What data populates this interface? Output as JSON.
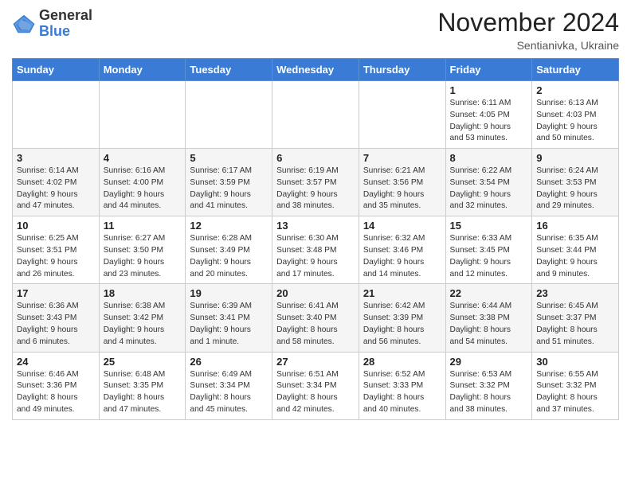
{
  "logo": {
    "general": "General",
    "blue": "Blue"
  },
  "header": {
    "month": "November 2024",
    "location": "Sentianivka, Ukraine"
  },
  "days_of_week": [
    "Sunday",
    "Monday",
    "Tuesday",
    "Wednesday",
    "Thursday",
    "Friday",
    "Saturday"
  ],
  "weeks": [
    [
      {
        "day": "",
        "info": ""
      },
      {
        "day": "",
        "info": ""
      },
      {
        "day": "",
        "info": ""
      },
      {
        "day": "",
        "info": ""
      },
      {
        "day": "",
        "info": ""
      },
      {
        "day": "1",
        "info": "Sunrise: 6:11 AM\nSunset: 4:05 PM\nDaylight: 9 hours\nand 53 minutes."
      },
      {
        "day": "2",
        "info": "Sunrise: 6:13 AM\nSunset: 4:03 PM\nDaylight: 9 hours\nand 50 minutes."
      }
    ],
    [
      {
        "day": "3",
        "info": "Sunrise: 6:14 AM\nSunset: 4:02 PM\nDaylight: 9 hours\nand 47 minutes."
      },
      {
        "day": "4",
        "info": "Sunrise: 6:16 AM\nSunset: 4:00 PM\nDaylight: 9 hours\nand 44 minutes."
      },
      {
        "day": "5",
        "info": "Sunrise: 6:17 AM\nSunset: 3:59 PM\nDaylight: 9 hours\nand 41 minutes."
      },
      {
        "day": "6",
        "info": "Sunrise: 6:19 AM\nSunset: 3:57 PM\nDaylight: 9 hours\nand 38 minutes."
      },
      {
        "day": "7",
        "info": "Sunrise: 6:21 AM\nSunset: 3:56 PM\nDaylight: 9 hours\nand 35 minutes."
      },
      {
        "day": "8",
        "info": "Sunrise: 6:22 AM\nSunset: 3:54 PM\nDaylight: 9 hours\nand 32 minutes."
      },
      {
        "day": "9",
        "info": "Sunrise: 6:24 AM\nSunset: 3:53 PM\nDaylight: 9 hours\nand 29 minutes."
      }
    ],
    [
      {
        "day": "10",
        "info": "Sunrise: 6:25 AM\nSunset: 3:51 PM\nDaylight: 9 hours\nand 26 minutes."
      },
      {
        "day": "11",
        "info": "Sunrise: 6:27 AM\nSunset: 3:50 PM\nDaylight: 9 hours\nand 23 minutes."
      },
      {
        "day": "12",
        "info": "Sunrise: 6:28 AM\nSunset: 3:49 PM\nDaylight: 9 hours\nand 20 minutes."
      },
      {
        "day": "13",
        "info": "Sunrise: 6:30 AM\nSunset: 3:48 PM\nDaylight: 9 hours\nand 17 minutes."
      },
      {
        "day": "14",
        "info": "Sunrise: 6:32 AM\nSunset: 3:46 PM\nDaylight: 9 hours\nand 14 minutes."
      },
      {
        "day": "15",
        "info": "Sunrise: 6:33 AM\nSunset: 3:45 PM\nDaylight: 9 hours\nand 12 minutes."
      },
      {
        "day": "16",
        "info": "Sunrise: 6:35 AM\nSunset: 3:44 PM\nDaylight: 9 hours\nand 9 minutes."
      }
    ],
    [
      {
        "day": "17",
        "info": "Sunrise: 6:36 AM\nSunset: 3:43 PM\nDaylight: 9 hours\nand 6 minutes."
      },
      {
        "day": "18",
        "info": "Sunrise: 6:38 AM\nSunset: 3:42 PM\nDaylight: 9 hours\nand 4 minutes."
      },
      {
        "day": "19",
        "info": "Sunrise: 6:39 AM\nSunset: 3:41 PM\nDaylight: 9 hours\nand 1 minute."
      },
      {
        "day": "20",
        "info": "Sunrise: 6:41 AM\nSunset: 3:40 PM\nDaylight: 8 hours\nand 58 minutes."
      },
      {
        "day": "21",
        "info": "Sunrise: 6:42 AM\nSunset: 3:39 PM\nDaylight: 8 hours\nand 56 minutes."
      },
      {
        "day": "22",
        "info": "Sunrise: 6:44 AM\nSunset: 3:38 PM\nDaylight: 8 hours\nand 54 minutes."
      },
      {
        "day": "23",
        "info": "Sunrise: 6:45 AM\nSunset: 3:37 PM\nDaylight: 8 hours\nand 51 minutes."
      }
    ],
    [
      {
        "day": "24",
        "info": "Sunrise: 6:46 AM\nSunset: 3:36 PM\nDaylight: 8 hours\nand 49 minutes."
      },
      {
        "day": "25",
        "info": "Sunrise: 6:48 AM\nSunset: 3:35 PM\nDaylight: 8 hours\nand 47 minutes."
      },
      {
        "day": "26",
        "info": "Sunrise: 6:49 AM\nSunset: 3:34 PM\nDaylight: 8 hours\nand 45 minutes."
      },
      {
        "day": "27",
        "info": "Sunrise: 6:51 AM\nSunset: 3:34 PM\nDaylight: 8 hours\nand 42 minutes."
      },
      {
        "day": "28",
        "info": "Sunrise: 6:52 AM\nSunset: 3:33 PM\nDaylight: 8 hours\nand 40 minutes."
      },
      {
        "day": "29",
        "info": "Sunrise: 6:53 AM\nSunset: 3:32 PM\nDaylight: 8 hours\nand 38 minutes."
      },
      {
        "day": "30",
        "info": "Sunrise: 6:55 AM\nSunset: 3:32 PM\nDaylight: 8 hours\nand 37 minutes."
      }
    ]
  ]
}
